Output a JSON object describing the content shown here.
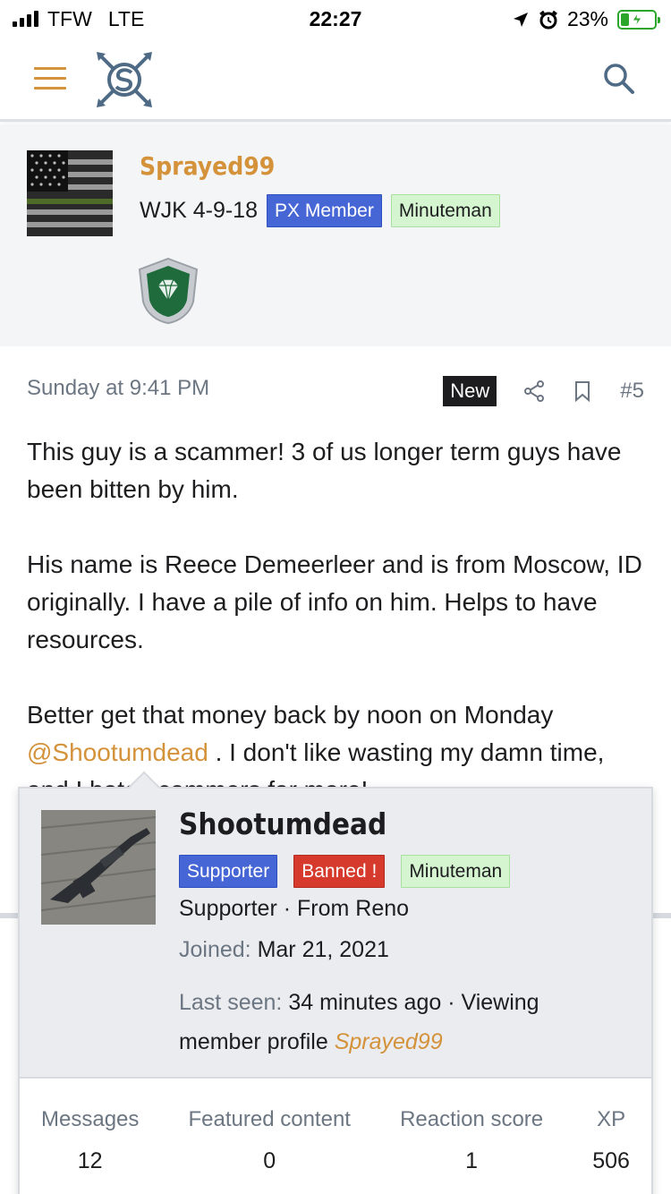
{
  "status_bar": {
    "carrier": "TFW",
    "network": "LTE",
    "time": "22:27",
    "battery_percent": "23%"
  },
  "header": {
    "menu_icon": "hamburger-menu-icon",
    "logo_icon": "site-logo",
    "search_icon": "search-icon",
    "accent_color": "#d4923a"
  },
  "poster": {
    "name": "Sprayed99",
    "title": "WJK 4-9-18",
    "badges": [
      "PX Member",
      "Minuteman"
    ],
    "trophy_icon": "diamond-shield-icon"
  },
  "post": {
    "date": "Sunday at 9:41 PM",
    "new_label": "New",
    "number": "#5",
    "paragraphs": [
      "This guy is a scammer! 3 of us longer term guys have been bitten by him.",
      "His name is Reece Demeerleer and is from Moscow, ID originally. I have a pile of info on him. Helps to have resources."
    ],
    "p3_start": "Better get that money back by noon on Monday",
    "mention": "@Shootumdead",
    "p3_end": ". I don't like wasting my damn",
    "p3_clipped": "time, and I hate scammers far more!"
  },
  "member_card": {
    "name": "Shootumdead",
    "badges": [
      "Supporter",
      "Banned !",
      "Minuteman"
    ],
    "title_line": "Supporter · From Reno",
    "joined_label": "Joined:",
    "joined_value": "Mar 21, 2021",
    "last_seen_label": "Last seen:",
    "last_seen_value": "34 minutes ago · Viewing",
    "activity_text": "member profile",
    "activity_link": "Sprayed99",
    "stats": [
      {
        "label": "Messages",
        "value": "12"
      },
      {
        "label": "Featured content",
        "value": "0"
      },
      {
        "label": "Reaction score",
        "value": "1"
      },
      {
        "label": "XP",
        "value": "506"
      }
    ]
  }
}
